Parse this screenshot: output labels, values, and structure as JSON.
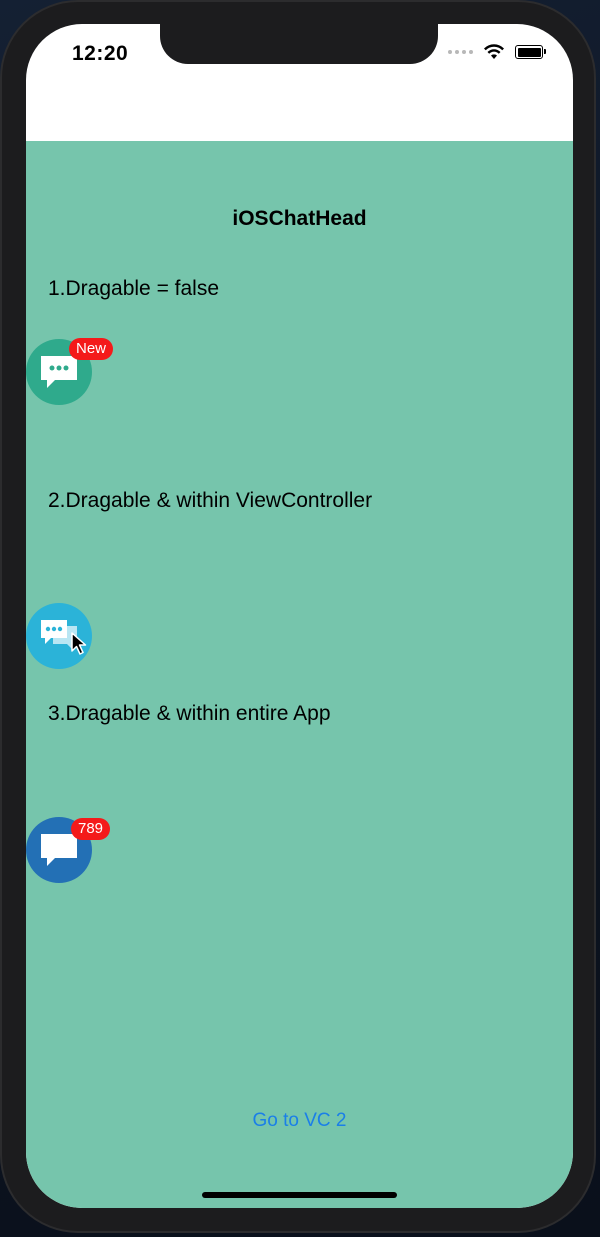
{
  "status_bar": {
    "time": "12:20"
  },
  "header": {
    "title": "iOSChatHead"
  },
  "sections": [
    {
      "label": "1.Dragable = false"
    },
    {
      "label": "2.Dragable & within ViewController"
    },
    {
      "label": "3.Dragable & within entire App"
    }
  ],
  "chat_heads": [
    {
      "icon": "chat-bubble-icon",
      "color": "#2faa8c",
      "badge": "New"
    },
    {
      "icon": "chat-bubbles-icon",
      "color": "#2bb3d8",
      "badge": ""
    },
    {
      "icon": "chat-bubble-icon",
      "color": "#2370b5",
      "badge": "789"
    }
  ],
  "footer": {
    "link_label": "Go to VC 2"
  }
}
